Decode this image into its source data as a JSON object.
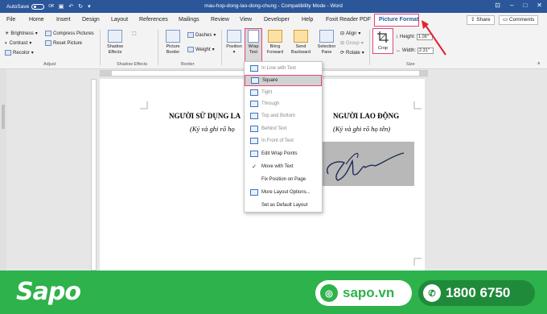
{
  "titlebar": {
    "autosave_label": "AutoSave",
    "autosave_state": "Off",
    "doc_title": "mau-hop-dong-lao-dong-chung  -  Compatibility Mode  -  Word"
  },
  "menu": {
    "tabs": [
      "File",
      "Home",
      "Insert",
      "Design",
      "Layout",
      "References",
      "Mailings",
      "Review",
      "View",
      "Developer",
      "Help",
      "Foxit Reader PDF",
      "Picture Format"
    ],
    "active_tab": "Picture Format",
    "share_label": "Share",
    "comments_label": "Comments"
  },
  "ribbon": {
    "brightness": "Brightness",
    "contrast": "Contrast",
    "recolor": "Recolor",
    "compress": "Compress Pictures",
    "reset": "Reset Picture",
    "adjust_group": "Adjust",
    "shadow_effects": [
      "Shadow",
      "Effects"
    ],
    "shadow_group": "Shadow Effects",
    "picture_border": [
      "Picture",
      "Border"
    ],
    "dashes": "Dashes",
    "weight": "Weight",
    "border_group": "Border",
    "position": "Position",
    "wrap_text": [
      "Wrap",
      "Text"
    ],
    "bring_forward": [
      "Bring",
      "Forward"
    ],
    "send_backward": [
      "Send",
      "Backward"
    ],
    "selection_pane": [
      "Selection",
      "Pane"
    ],
    "align": "Align",
    "group": "Group",
    "rotate": "Rotate",
    "crop": "Crop",
    "height_label": "Height:",
    "height_value": "1.09\"",
    "width_label": "Width:",
    "width_value": "2.31\"",
    "size_group": "Size"
  },
  "document": {
    "left_title": "NGƯỜI SỬ DỤNG LA",
    "left_sub": "(Ký và ghi rõ họ",
    "right_title": "NGƯỜI LAO ĐỘNG",
    "right_sub": "(Ký và ghi rõ họ tên)"
  },
  "wrap_menu": {
    "items": [
      {
        "label": "In Line with Text",
        "grey": true
      },
      {
        "label": "Square",
        "highlighted": true
      },
      {
        "label": "Tight",
        "grey": true
      },
      {
        "label": "Through",
        "grey": true
      },
      {
        "label": "Top and Bottom",
        "grey": true
      },
      {
        "label": "Behind Text",
        "grey": true
      },
      {
        "label": "In Front of Text",
        "grey": true
      },
      {
        "label": "Edit Wrap Points"
      },
      {
        "label": "Move with Text",
        "checked": true
      },
      {
        "label": "Fix Position on Page"
      },
      {
        "label": "More Layout Options..."
      },
      {
        "label": "Set as Default Layout"
      }
    ]
  },
  "banner": {
    "logo": "Sapo",
    "website": "sapo.vn",
    "phone": "1800 6750"
  },
  "colors": {
    "word_blue": "#2b579a",
    "highlight_pink": "#e0457b",
    "sapo_green": "#2eb24b",
    "annotation_red": "#e0242f"
  }
}
